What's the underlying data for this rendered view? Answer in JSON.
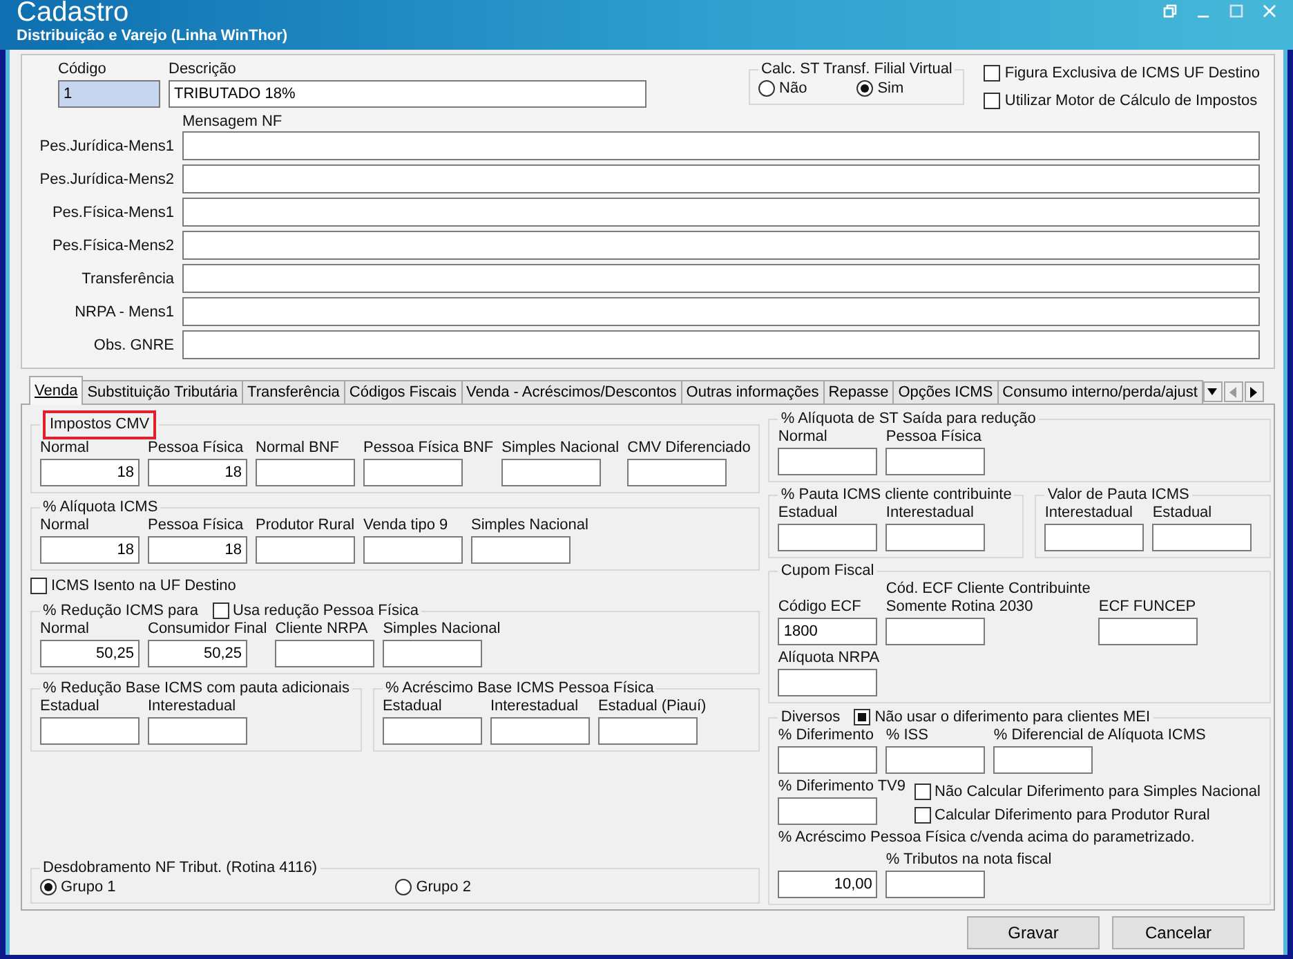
{
  "window": {
    "title": "Cadastro",
    "subtitle": "Distribuição e Varejo (Linha WinThor)"
  },
  "header": {
    "codigo": {
      "label": "Código",
      "value": "1"
    },
    "descricao": {
      "label": "Descrição",
      "value": "TRIBUTADO 18%"
    },
    "calc_st": {
      "title": "Calc. ST Transf. Filial Virtual",
      "options": [
        {
          "label": "Não",
          "selected": false
        },
        {
          "label": "Sim",
          "selected": true
        }
      ]
    },
    "checks": [
      {
        "label": "Figura Exclusiva de ICMS UF Destino",
        "checked": false
      },
      {
        "label": "Utilizar Motor de Cálculo de Impostos",
        "checked": false
      }
    ]
  },
  "message_label": "Mensagem NF",
  "messages": [
    {
      "label": "Pes.Jurídica-Mens1"
    },
    {
      "label": "Pes.Jurídica-Mens2"
    },
    {
      "label": "Pes.Física-Mens1"
    },
    {
      "label": "Pes.Física-Mens2"
    },
    {
      "label": "Transferência"
    },
    {
      "label": "NRPA - Mens1"
    },
    {
      "label": "Obs. GNRE"
    }
  ],
  "tabs": [
    {
      "label": "Venda",
      "selected": true
    },
    {
      "label": "Substituição Tributária",
      "selected": false
    },
    {
      "label": "Transferência",
      "selected": false
    },
    {
      "label": "Códigos Fiscais",
      "selected": false
    },
    {
      "label": "Venda - Acréscimos/Descontos",
      "selected": false
    },
    {
      "label": "Outras informações",
      "selected": false
    },
    {
      "label": "Repasse",
      "selected": false
    },
    {
      "label": "Opções ICMS",
      "selected": false
    },
    {
      "label": "Consumo interno/perda/ajust",
      "selected": false
    }
  ],
  "left": [
    {
      "kind": "group",
      "title": "Impostos CMV",
      "highlighted": true,
      "rows": [
        [
          {
            "kind": "field",
            "label": "Normal",
            "value": "18",
            "numeric": true
          },
          {
            "kind": "field",
            "label": "Pessoa Física",
            "value": "18",
            "numeric": true
          },
          {
            "kind": "field",
            "label": "Normal BNF"
          },
          {
            "kind": "field",
            "label": "Pessoa Física BNF"
          },
          {
            "kind": "field",
            "label": "Simples Nacional"
          },
          {
            "kind": "field",
            "label": "CMV Diferenciado"
          }
        ]
      ]
    },
    {
      "kind": "group",
      "title": "% Alíquota ICMS",
      "highlighted": false,
      "rows": [
        [
          {
            "kind": "field",
            "label": "Normal",
            "value": "18",
            "numeric": true
          },
          {
            "kind": "field",
            "label": "Pessoa Física",
            "value": "18",
            "numeric": true
          },
          {
            "kind": "field",
            "label": "Produtor Rural"
          },
          {
            "kind": "field",
            "label": "Venda tipo 9"
          },
          {
            "kind": "field",
            "label": "Simples Nacional"
          }
        ]
      ]
    },
    {
      "kind": "check",
      "label": "ICMS Isento na UF Destino",
      "checked": false
    },
    {
      "kind": "group",
      "title": "% Redução ICMS para",
      "highlighted": false,
      "check": {
        "label": "Usa redução Pessoa Física",
        "checked": false
      },
      "rows": [
        [
          {
            "kind": "field",
            "label": "Normal",
            "value": "50,25",
            "numeric": true
          },
          {
            "kind": "field",
            "label": "Consumidor Final",
            "value": "50,25",
            "numeric": true
          },
          {
            "kind": "field",
            "label": "Cliente NRPA"
          },
          {
            "kind": "field",
            "label": "Simples Nacional"
          }
        ]
      ]
    },
    {
      "kind": "pair",
      "groups": [
        {
          "kind": "group",
          "title": "% Redução Base ICMS com pauta adicionais",
          "highlighted": false,
          "rows": [
            [
              {
                "kind": "field",
                "label": "Estadual"
              },
              {
                "kind": "field",
                "label": "Interestadual"
              }
            ]
          ]
        },
        {
          "kind": "group",
          "title": "% Acréscimo Base ICMS Pessoa Física",
          "highlighted": false,
          "rows": [
            [
              {
                "kind": "field",
                "label": "Estadual"
              },
              {
                "kind": "field",
                "label": "Interestadual"
              },
              {
                "kind": "field",
                "label": "Estadual (Piauí)"
              }
            ]
          ]
        }
      ]
    },
    {
      "kind": "radios",
      "title": "Desdobramento NF Tribut. (Rotina 4116)",
      "options": [
        {
          "label": "Grupo 1",
          "selected": true
        },
        {
          "label": "Grupo 2",
          "selected": false
        }
      ]
    }
  ],
  "right": [
    {
      "kind": "group",
      "title": "% Alíquota de ST Saída para redução",
      "highlighted": false,
      "rows": [
        [
          {
            "kind": "field",
            "label": "Normal"
          },
          {
            "kind": "field",
            "label": "Pessoa Física"
          }
        ]
      ]
    },
    {
      "kind": "pair",
      "groups": [
        {
          "kind": "group",
          "title": "% Pauta ICMS cliente contribuinte",
          "highlighted": false,
          "rows": [
            [
              {
                "kind": "field",
                "label": "Estadual"
              },
              {
                "kind": "field",
                "label": "Interestadual"
              }
            ]
          ]
        },
        {
          "kind": "group",
          "title": "Valor de Pauta ICMS",
          "highlighted": false,
          "rows": [
            [
              {
                "kind": "field",
                "label": "Interestadual"
              },
              {
                "kind": "field",
                "label": "Estadual"
              }
            ]
          ]
        }
      ]
    },
    {
      "kind": "group",
      "title": "Cupom Fiscal",
      "highlighted": false,
      "rows": [
        [
          {
            "kind": "field",
            "label": "Código ECF",
            "value": "1800"
          },
          {
            "kind": "field",
            "label": "Cód. ECF Cliente Contribuinte\nSomente Rotina 2030"
          },
          {
            "kind": "field",
            "label": "ECF FUNCEP"
          }
        ],
        [
          {
            "kind": "field",
            "label": "Alíquota NRPA"
          }
        ]
      ]
    },
    {
      "kind": "group",
      "title": "Diversos",
      "highlighted": false,
      "check": {
        "label": "Não usar o diferimento para clientes MEI",
        "checked": true
      },
      "rows": [
        [
          {
            "kind": "field",
            "label": "% Diferimento"
          },
          {
            "kind": "field",
            "label": "% ISS"
          },
          {
            "kind": "field",
            "label": "% Diferencial de Alíquota ICMS"
          }
        ],
        [
          {
            "kind": "field",
            "label": "% Diferimento TV9"
          },
          {
            "kind": "checks",
            "items": [
              {
                "label": "Não Calcular Diferimento para Simples Nacional",
                "checked": false
              },
              {
                "label": "Calcular Diferimento para Produtor Rural",
                "checked": false
              }
            ]
          }
        ],
        [
          {
            "kind": "text",
            "label": "% Acréscimo Pessoa Física c/venda acima do parametrizado."
          }
        ],
        [
          {
            "kind": "field",
            "value": "10,00",
            "numeric": true
          },
          {
            "kind": "field",
            "label": "% Tributos na nota fiscal"
          }
        ]
      ]
    }
  ],
  "buttons": [
    "Gravar",
    "Cancelar"
  ]
}
